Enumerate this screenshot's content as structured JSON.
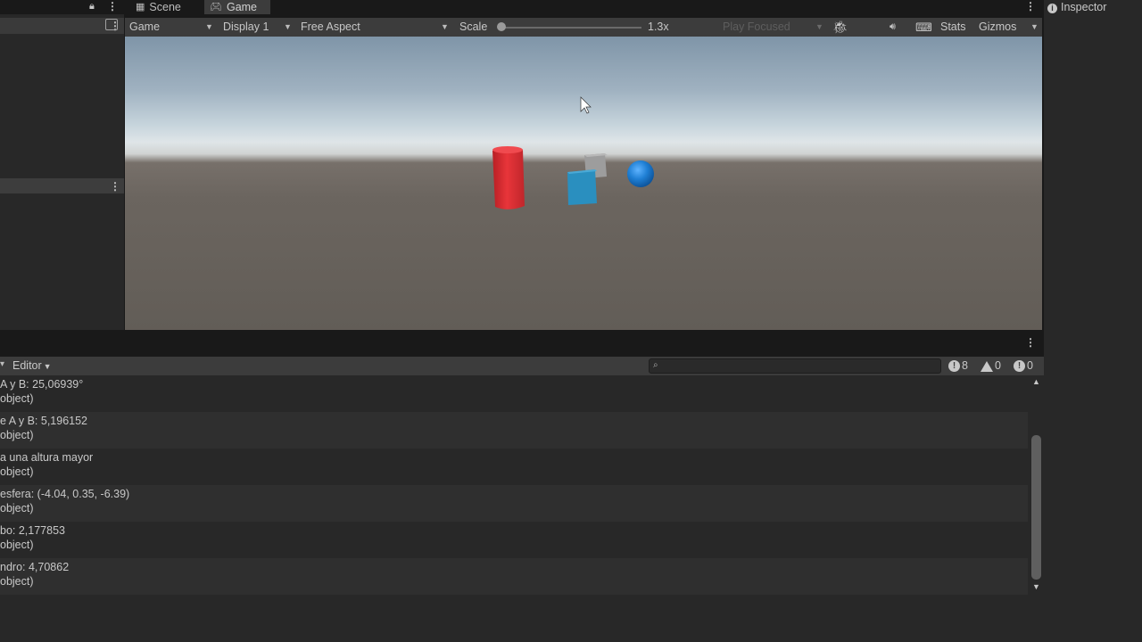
{
  "tabs": {
    "scene": "Scene",
    "game": "Game",
    "inspector": "Inspector"
  },
  "game_toolbar": {
    "view_mode": "Game",
    "display": "Display 1",
    "aspect": "Free Aspect",
    "scale_label": "Scale",
    "scale_value": "1.3x",
    "scale_fraction": 0.0,
    "play_mode": "Play Focused",
    "stats": "Stats",
    "gizmos": "Gizmos"
  },
  "console": {
    "editor_label": "Editor",
    "counts": {
      "info": "8",
      "warnings": "0",
      "errors": "0"
    },
    "logs": [
      {
        "line1": "A y B: 25,06939°",
        "line2": "object)"
      },
      {
        "line1": "e A y B: 5,196152",
        "line2": "object)"
      },
      {
        "line1": "a una altura mayor",
        "line2": "object)"
      },
      {
        "line1": "esfera: (-4.04, 0.35, -6.39)",
        "line2": "object)"
      },
      {
        "line1": "bo: 2,177853",
        "line2": "object)"
      },
      {
        "line1": "ndro: 4,70862",
        "line2": "object)"
      }
    ]
  },
  "colors": {
    "cylinder": "#e12d31",
    "cube_blue": "#2a8fbf",
    "cube_gray": "#9a9a9a",
    "sphere": "#1f7fd4"
  }
}
